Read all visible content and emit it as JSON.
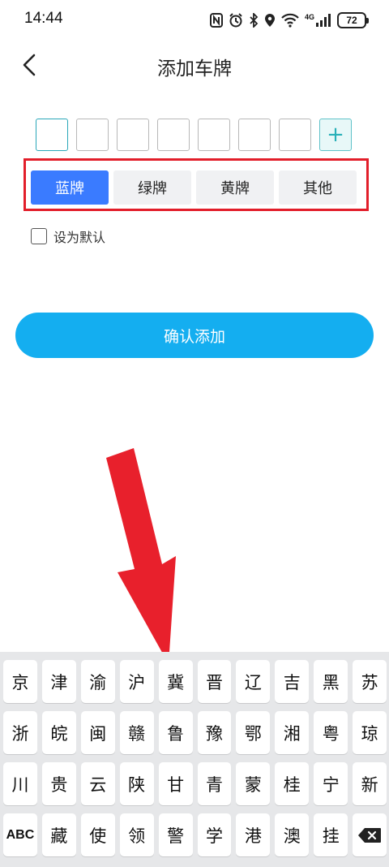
{
  "status_bar": {
    "time": "14:44",
    "network": "4G",
    "battery": "72"
  },
  "header": {
    "title": "添加车牌"
  },
  "plate_input": {
    "cells": [
      "",
      "",
      "",
      "",
      "",
      "",
      ""
    ],
    "add_label": "+"
  },
  "plate_types": [
    {
      "label": "蓝牌",
      "selected": true
    },
    {
      "label": "绿牌",
      "selected": false
    },
    {
      "label": "黄牌",
      "selected": false
    },
    {
      "label": "其他",
      "selected": false
    }
  ],
  "default_option": {
    "label": "设为默认",
    "checked": false
  },
  "confirm_button": {
    "label": "确认添加"
  },
  "colors": {
    "primary": "#14aef0",
    "selected_type": "#3a7bff",
    "highlight": "#e21e2a",
    "arrow": "#e8202c"
  },
  "keyboard": {
    "rows": [
      [
        "京",
        "津",
        "渝",
        "沪",
        "冀",
        "晋",
        "辽",
        "吉",
        "黑",
        "苏"
      ],
      [
        "浙",
        "皖",
        "闽",
        "赣",
        "鲁",
        "豫",
        "鄂",
        "湘",
        "粤",
        "琼"
      ],
      [
        "川",
        "贵",
        "云",
        "陕",
        "甘",
        "青",
        "蒙",
        "桂",
        "宁",
        "新"
      ],
      [
        "ABC",
        "藏",
        "使",
        "领",
        "警",
        "学",
        "港",
        "澳",
        "挂"
      ]
    ],
    "backspace_icon": "backspace-icon"
  }
}
